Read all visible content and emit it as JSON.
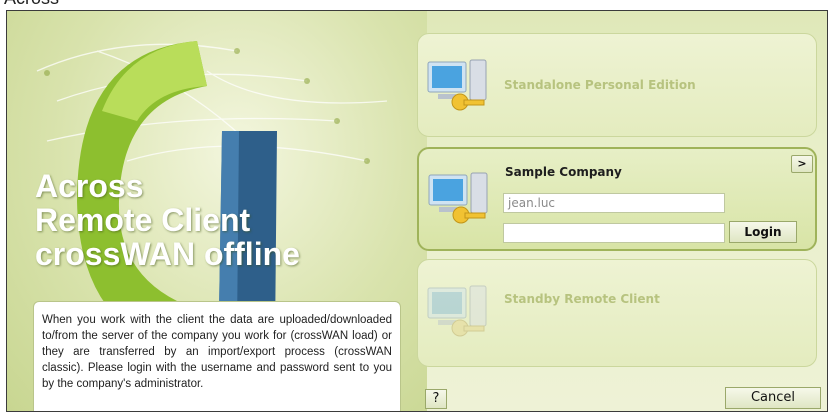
{
  "window": {
    "title": "Across"
  },
  "brand": {
    "line1": "Across",
    "line2": "Remote Client",
    "line3": "crossWAN offline"
  },
  "info": {
    "text": "When you work with the client the data are uploaded/downloaded to/from the server of the company you work for (crossWAN load) or they are transferred by an import/export process (crossWAN classic). Please login with the username and password sent to you by the company's administrator."
  },
  "panels": {
    "standalone": {
      "label": "Standalone Personal Edition"
    },
    "company": {
      "label": "Sample Company",
      "username_value": "jean.luc",
      "password_value": "",
      "login_label": "Login",
      "more_label": ">"
    },
    "standby": {
      "label": "Standby Remote Client"
    }
  },
  "footer": {
    "help_label": "?",
    "cancel_label": "Cancel"
  },
  "colors": {
    "accent_green": "#9fb35a",
    "panel_bg": "#e4ecbf",
    "brand_text": "#ffffff"
  },
  "icons": [
    "computer-key-icon"
  ]
}
